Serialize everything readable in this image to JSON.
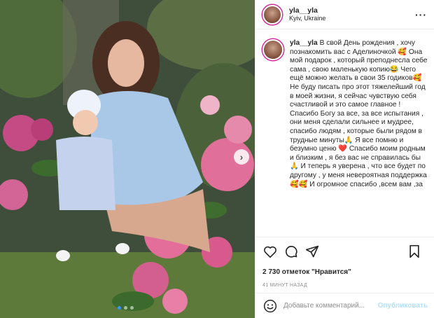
{
  "post": {
    "username": "yla__yla",
    "location": "Kyiv, Ukraine",
    "caption": "В свой День рождения , хочу познакомить вас с Аделиночкой 🥰 Она мой подарок , который преподнесла себе сама , свою маленькую копию😂 Чего ещё можно желать в свои 35 годиков🥰 Не буду писать про этот тяжелейший год в моей жизни, я сейчас чувствую себя счастливой и это самое главное ! Спасибо Богу за все, за все испытания , они меня сделали сильнее и мудрее, спасибо людям , которые были рядом в трудные минуты🙏 Я все помню и безумно ценю ❤️ Спасибо моим родным и близким , я без вас не справилась бы 🙏 И теперь я уверена , что все будет по другому , у меня невероятная поддержка 🥰🥰 И огромное спасибо ,всем вам ,за",
    "likes": "2 730 отметок \"Нравится\"",
    "time": "41 МИНУТ НАЗАД"
  },
  "comment": {
    "placeholder": "Добавьте комментарий...",
    "post_label": "Опубликовать"
  },
  "carousel": {
    "count": 3,
    "active": 0
  },
  "icons": {
    "header_more": "more-icon",
    "like": "heart-icon",
    "comment": "comment-icon",
    "share": "share-icon",
    "save": "bookmark-icon",
    "emoji": "emoji-icon",
    "next": "chevron-right-icon"
  },
  "colors": {
    "accent": "#3897f0",
    "post_disabled": "#b2dffc",
    "story_ring": "#d6249f"
  }
}
